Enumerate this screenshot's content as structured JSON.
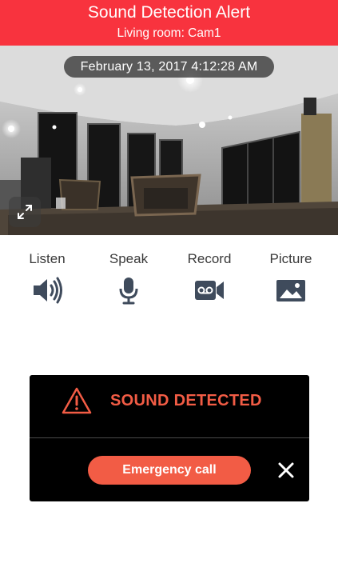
{
  "header": {
    "title": "Sound Detection Alert",
    "subtitle": "Living room: Cam1"
  },
  "video": {
    "timestamp": "February 13, 2017   4:12:28 AM",
    "camera_id": "CAM0001",
    "expand_icon": "expand-icon"
  },
  "controls": [
    {
      "label": "Listen",
      "icon": "speaker-icon"
    },
    {
      "label": "Speak",
      "icon": "microphone-icon"
    },
    {
      "label": "Record",
      "icon": "video-record-icon"
    },
    {
      "label": "Picture",
      "icon": "picture-icon"
    }
  ],
  "alert": {
    "title": "SOUND DETECTED",
    "warning_icon": "warning-icon",
    "emergency_button": "Emergency call",
    "close_icon": "close-icon"
  },
  "colors": {
    "header_bg": "#f8333e",
    "accent": "#f25c45",
    "icon": "#3f4b5c",
    "alert_bg": "#000000"
  }
}
